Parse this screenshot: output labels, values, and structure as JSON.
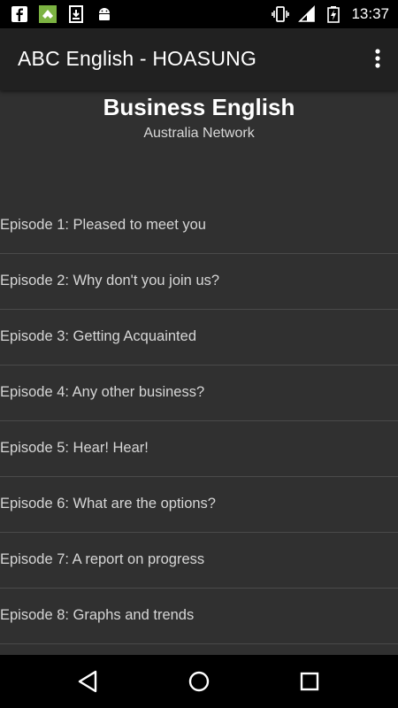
{
  "status_bar": {
    "left_icons": [
      "facebook-icon",
      "feedly-icon",
      "download-icon",
      "android-icon"
    ],
    "right_icons": [
      "vibrate-icon",
      "signal-icon",
      "battery-charging-icon"
    ],
    "time": "13:37"
  },
  "app_bar": {
    "title": "ABC English - HOASUNG",
    "overflow_icon": "more-vert-icon"
  },
  "header": {
    "title": "Business English",
    "subtitle": "Australia Network"
  },
  "episodes": [
    {
      "label": "Episode 1: Pleased to meet you"
    },
    {
      "label": "Episode 2: Why don't you join us?"
    },
    {
      "label": "Episode 3: Getting Acquainted"
    },
    {
      "label": "Episode 4: Any other business?"
    },
    {
      "label": "Episode 5: Hear! Hear!"
    },
    {
      "label": "Episode 6: What are the options?"
    },
    {
      "label": "Episode 7: A report on progress"
    },
    {
      "label": "Episode 8: Graphs and trends"
    }
  ],
  "nav_bar": {
    "icons": [
      "back-icon",
      "home-icon",
      "recents-icon"
    ]
  },
  "colors": {
    "background": "#303030",
    "app_bar": "#212121",
    "status_bar": "#000000",
    "text_primary": "#ffffff",
    "text_secondary": "#d6d6d6",
    "divider": "#4a4a4a"
  }
}
